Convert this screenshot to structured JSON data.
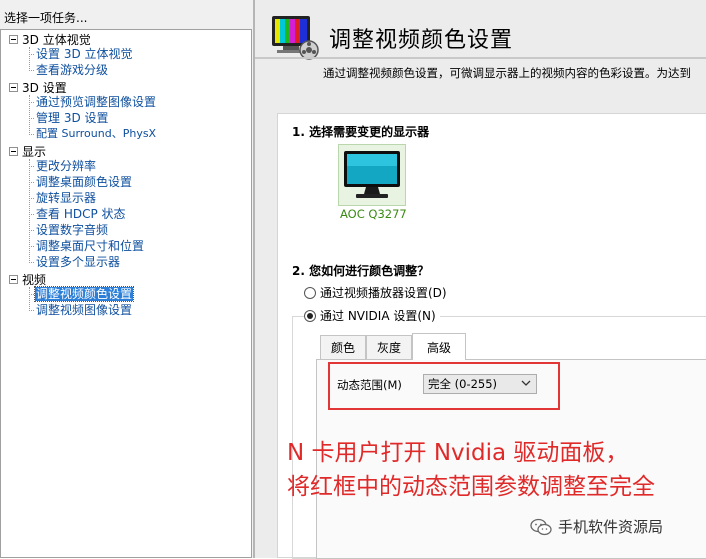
{
  "left_panel": {
    "title": "选择一项任务...",
    "categories": [
      {
        "label": "3D 立体视觉",
        "items": [
          "设置 3D 立体视觉",
          "查看游戏分级"
        ]
      },
      {
        "label": "3D 设置",
        "items": [
          "通过预览调整图像设置",
          "管理 3D 设置",
          "配置 Surround、PhysX"
        ]
      },
      {
        "label": "显示",
        "items": [
          "更改分辨率",
          "调整桌面颜色设置",
          "旋转显示器",
          "查看 HDCP 状态",
          "设置数字音频",
          "调整桌面尺寸和位置",
          "设置多个显示器"
        ]
      },
      {
        "label": "视频",
        "items": [
          "调整视频颜色设置",
          "调整视频图像设置"
        ]
      }
    ],
    "selected_item": "调整视频颜色设置"
  },
  "header": {
    "title": "调整视频颜色设置",
    "description": "通过调整视频颜色设置，可微调显示器上的视频内容的色彩设置。为达到"
  },
  "section1": {
    "title": "1. 选择需要变更的显示器",
    "monitor_name": "AOC Q3277"
  },
  "section2": {
    "title": "2. 您如何进行颜色调整？",
    "radio_options": [
      {
        "label": "通过视频播放器设置(D)",
        "checked": false
      },
      {
        "label": "通过 NVIDIA 设置(N)",
        "checked": true
      }
    ],
    "tabs": [
      "颜色",
      "灰度",
      "高级"
    ],
    "active_tab": "高级",
    "dynamic_range_label": "动态范围(M)",
    "dynamic_range_value": "完全 (0-255)"
  },
  "annotation": {
    "line1": "N 卡用户打开 Nvidia 驱动面板，",
    "line2": "将红框中的动态范围参数调整至完全"
  },
  "watermark": "手机软件资源局",
  "colors": {
    "link": "#0e4f9e",
    "selection": "#2c7fd8",
    "monitor_label": "#3a8a13",
    "annotation": "#e02a2a"
  }
}
